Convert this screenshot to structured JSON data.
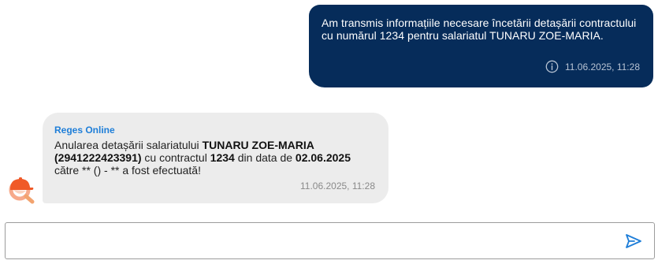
{
  "messages": {
    "outgoing": {
      "text": "Am transmis informațiile necesare încetării detașării contractului cu numărul 1234 pentru salariatul TUNARU ZOE-MARIA.",
      "time": "11.06.2025, 11:28",
      "info_icon": "info-icon"
    },
    "incoming": {
      "sender": "Reges Online",
      "segments": {
        "s1": "Anularea detașării salariatului ",
        "s2": "TUNARU ZOE-MARIA",
        "s3": " ",
        "s4": "(2941222423391)",
        "s5": " cu contractul ",
        "s6": "1234",
        "s7": " din data de ",
        "s8": "02.06.2025",
        "s9": " către ** () - ** a fost efectuată!"
      },
      "time": "11.06.2025, 11:28"
    }
  },
  "composer": {
    "placeholder": "",
    "value": "",
    "send_icon": "send-icon"
  },
  "colors": {
    "outgoing_bg": "#062c5a",
    "incoming_bg": "#ececec",
    "sender": "#1e7ed8",
    "send_icon": "#1e7ed8",
    "avatar_orange": "#f05a28"
  }
}
